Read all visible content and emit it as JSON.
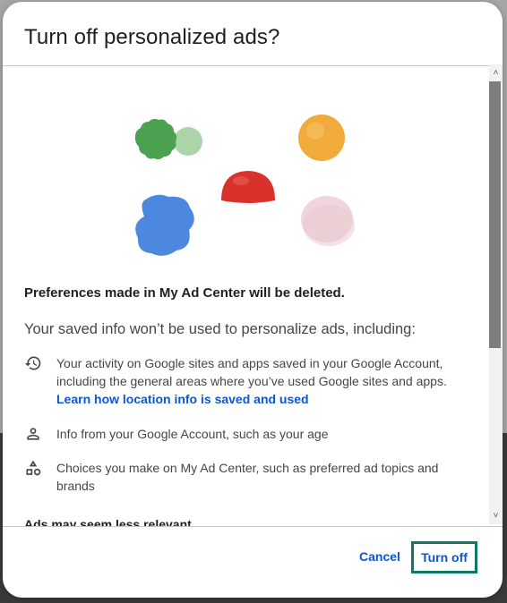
{
  "dialog": {
    "title": "Turn off personalized ads?",
    "deleted_notice": "Preferences made in My Ad Center will be deleted.",
    "subheading": "Your saved info won’t be used to personalize ads, including:",
    "items": [
      {
        "icon": "history-icon",
        "text": "Your activity on Google sites and apps saved in your Google Account, including the general areas where you’ve used Google sites and apps.",
        "link": "Learn how location info is saved and used"
      },
      {
        "icon": "person-icon",
        "text": "Info from your Google Account, such as your age"
      },
      {
        "icon": "shapes-icon",
        "text": "Choices you make on My Ad Center, such as preferred ad topics and brands"
      }
    ],
    "section_label": "Ads may seem less relevant",
    "buttons": {
      "cancel": "Cancel",
      "turn_off": "Turn off"
    }
  },
  "colors": {
    "link": "#0b57d0",
    "focus_outline": "#0d7a67",
    "text_primary": "#1f1f1f",
    "text_secondary": "#444746"
  }
}
